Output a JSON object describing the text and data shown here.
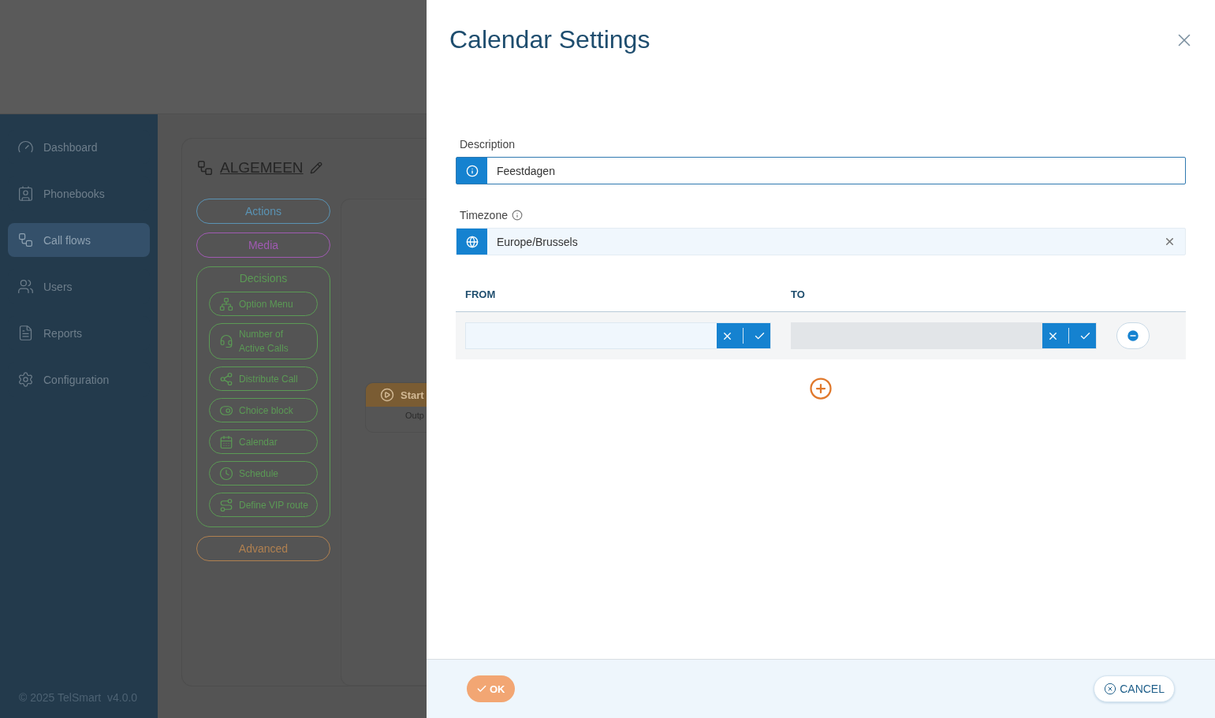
{
  "sidebar": {
    "items": [
      {
        "label": "Dashboard",
        "selected": false
      },
      {
        "label": "Phonebooks",
        "selected": false
      },
      {
        "label": "Call flows",
        "selected": true
      },
      {
        "label": "Users",
        "selected": false
      },
      {
        "label": "Reports",
        "selected": false
      },
      {
        "label": "Configuration",
        "selected": false
      }
    ],
    "footer": "© 2025 TelSmart  v4.0.0"
  },
  "flow": {
    "title": "ALGEMEEN",
    "groups": [
      {
        "label": "Actions",
        "color": "#5a93b4"
      },
      {
        "label": "Media",
        "color": "#a05ab2"
      },
      {
        "label": "Decisions",
        "color": "#5b9a55",
        "items": [
          "Option Menu",
          "Number of Active Calls",
          "Distribute Call",
          "Choice block",
          "Calendar",
          "Schedule",
          "Define VIP route"
        ]
      },
      {
        "label": "Advanced",
        "color": "#b08050"
      }
    ],
    "start_node": {
      "label": "Start",
      "output": "Outp"
    }
  },
  "dialog": {
    "title": "Calendar Settings",
    "description": {
      "label": "Description",
      "value": "Feestdagen"
    },
    "timezone": {
      "label": "Timezone",
      "value": "Europe/Brussels"
    },
    "columns": [
      "FROM",
      "TO"
    ],
    "rows": [
      {
        "from_disabled": false,
        "to_disabled": true
      }
    ],
    "ok": "OK",
    "cancel": "CANCEL"
  }
}
